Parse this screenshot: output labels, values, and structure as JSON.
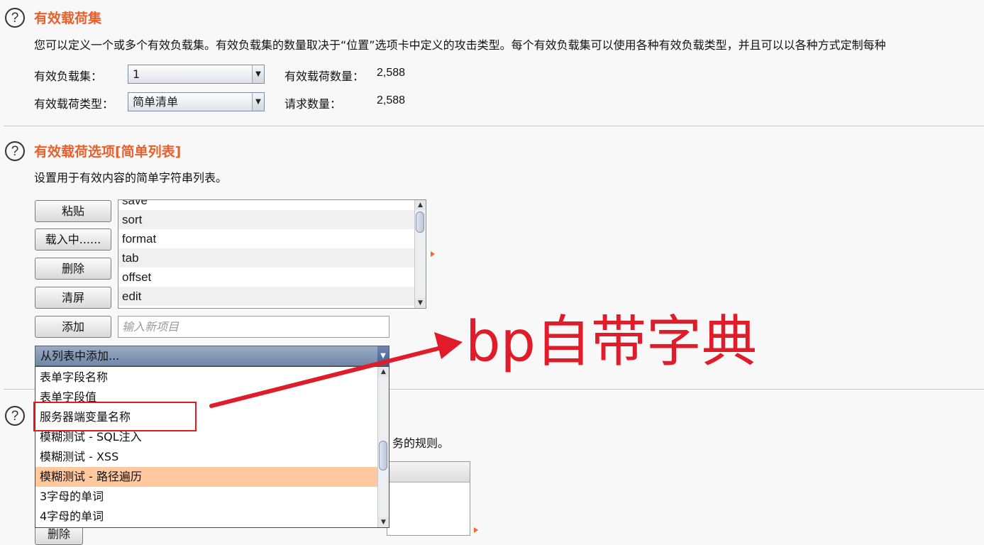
{
  "payload_sets": {
    "title": "有效载荷集",
    "description": "您可以定义一个或多个有效负载集。有效负载集的数量取决于“位置”选项卡中定义的攻击类型。每个有效负载集可以使用各种有效负载类型，并且可以以各种方式定制每种",
    "payload_set_label": "有效负载集：",
    "payload_set_value": "1",
    "payload_type_label": "有效载荷类型：",
    "payload_type_value": "简单清单",
    "payload_count_label": "有效载荷数量：",
    "payload_count_value": "2,588",
    "request_count_label": "请求数量：",
    "request_count_value": "2,588"
  },
  "payload_options": {
    "title": "有效载荷选项[简单列表]",
    "description": "设置用于有效内容的简单字符串列表。",
    "buttons": {
      "paste": "粘贴",
      "load": "载入中......",
      "remove": "删除",
      "clear": "清屏",
      "add": "添加"
    },
    "list_items": [
      "save",
      "sort",
      "format",
      "tab",
      "offset",
      "edit"
    ],
    "new_item_placeholder": "输入新项目",
    "add_from_list_label": "从列表中添加...",
    "dropdown_items": [
      "表单字段名称",
      "表单字段值",
      "服务器端变量名称",
      "模糊测试 -  SQL注入",
      "模糊测试 -  XSS",
      "模糊测试 - 路径遍历",
      "3字母的单词",
      "4字母的单词"
    ],
    "selected_dropdown_index": 5
  },
  "third_section": {
    "description_fragment": "务的规则。",
    "remove_button": "删除"
  },
  "annotation": {
    "text": "bp自带字典",
    "color": "#e01c2a"
  },
  "colors": {
    "section_title": "#e8602c",
    "selected_item": "#ffc89f",
    "annotation_red": "#e01c2a"
  }
}
